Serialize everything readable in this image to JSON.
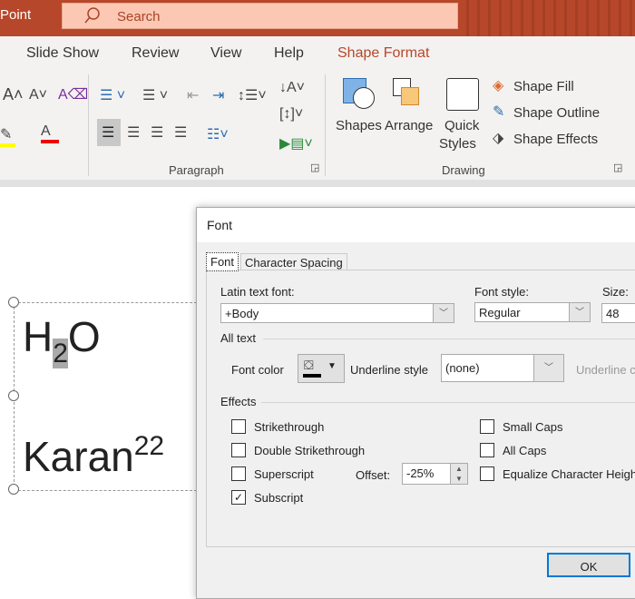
{
  "titlebar": {
    "app_name": "Point",
    "search_placeholder": "Search"
  },
  "tabs": [
    "Slide Show",
    "Review",
    "View",
    "Help",
    "Shape Format"
  ],
  "accent": "#b7472a",
  "ribbon": {
    "paragraph_label": "Paragraph",
    "drawing_label": "Drawing",
    "shapes": "Shapes",
    "arrange": "Arrange",
    "quick": "Quick",
    "styles": "Styles",
    "shape_fill": "Shape Fill",
    "shape_outline": "Shape Outline",
    "shape_effects": "Shape Effects"
  },
  "slide": {
    "h": "H",
    "sub": "2",
    "o": "O",
    "karan": "Karan",
    "sup": "22"
  },
  "dialog": {
    "title": "Font",
    "tab_font": "Font",
    "tab_spacing": "Character Spacing",
    "latin_label": "Latin text font:",
    "latin_value": "+Body",
    "style_label": "Font style:",
    "style_value": "Regular",
    "size_label": "Size:",
    "size_value": "48",
    "all_text": "All text",
    "font_color": "Font color",
    "underline_style": "Underline style",
    "underline_value": "(none)",
    "underline_color": "Underline c",
    "effects": "Effects",
    "strikethrough": "Strikethrough",
    "double_strike": "Double Strikethrough",
    "superscript": "Superscript",
    "subscript": "Subscript",
    "small_caps": "Small Caps",
    "all_caps": "All Caps",
    "equalize": "Equalize Character Height",
    "offset_label": "Offset:",
    "offset_value": "-25%",
    "ok": "OK"
  }
}
